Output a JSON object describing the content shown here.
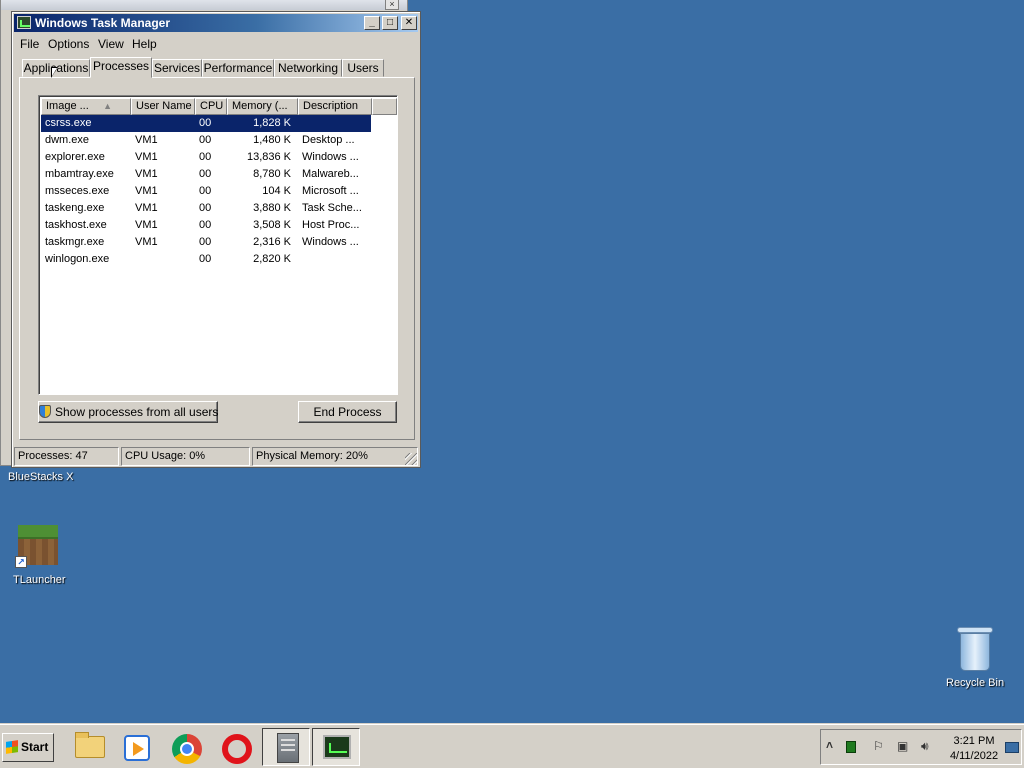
{
  "task_manager": {
    "title": "Windows Task Manager",
    "menu": [
      "File",
      "Options",
      "View",
      "Help"
    ],
    "tabs": [
      "Applications",
      "Processes",
      "Services",
      "Performance",
      "Networking",
      "Users"
    ],
    "active_tab": "Processes",
    "columns": [
      "Image ...",
      "User Name",
      "CPU",
      "Memory (...",
      "Description"
    ],
    "processes": [
      {
        "image": "csrss.exe",
        "user": "",
        "cpu": "00",
        "memory": "1,828 K",
        "description": ""
      },
      {
        "image": "dwm.exe",
        "user": "VM1",
        "cpu": "00",
        "memory": "1,480 K",
        "description": "Desktop ..."
      },
      {
        "image": "explorer.exe",
        "user": "VM1",
        "cpu": "00",
        "memory": "13,836 K",
        "description": "Windows ..."
      },
      {
        "image": "mbamtray.exe",
        "user": "VM1",
        "cpu": "00",
        "memory": "8,780 K",
        "description": "Malwareb..."
      },
      {
        "image": "msseces.exe",
        "user": "VM1",
        "cpu": "00",
        "memory": "104 K",
        "description": "Microsoft ..."
      },
      {
        "image": "taskeng.exe",
        "user": "VM1",
        "cpu": "00",
        "memory": "3,880 K",
        "description": "Task Sche..."
      },
      {
        "image": "taskhost.exe",
        "user": "VM1",
        "cpu": "00",
        "memory": "3,508 K",
        "description": "Host Proc..."
      },
      {
        "image": "taskmgr.exe",
        "user": "VM1",
        "cpu": "00",
        "memory": "2,316 K",
        "description": "Windows ..."
      },
      {
        "image": "winlogon.exe",
        "user": "",
        "cpu": "00",
        "memory": "2,820 K",
        "description": ""
      }
    ],
    "selected_process": "csrss.exe",
    "show_all_button": "Show processes from all users",
    "end_process_button": "End Process",
    "status": {
      "processes": "Processes: 47",
      "cpu": "CPU Usage: 0%",
      "memory": "Physical Memory: 20%"
    }
  },
  "desktop": {
    "icons": [
      {
        "label": "BlueStacks X",
        "icon": "bluestacks-icon"
      },
      {
        "label": "TLauncher",
        "icon": "minecraft-grass-block-icon"
      },
      {
        "label": "Recycle Bin",
        "icon": "recycle-bin-icon"
      }
    ],
    "background_color": "#3a6ea5"
  },
  "taskbar": {
    "start_label": "Start",
    "pinned": [
      "folder-icon",
      "media-player-icon",
      "chrome-icon",
      "opera-icon",
      "server-icon",
      "task-manager-icon"
    ],
    "clock_time": "3:21 PM",
    "clock_date": "4/11/2022"
  }
}
